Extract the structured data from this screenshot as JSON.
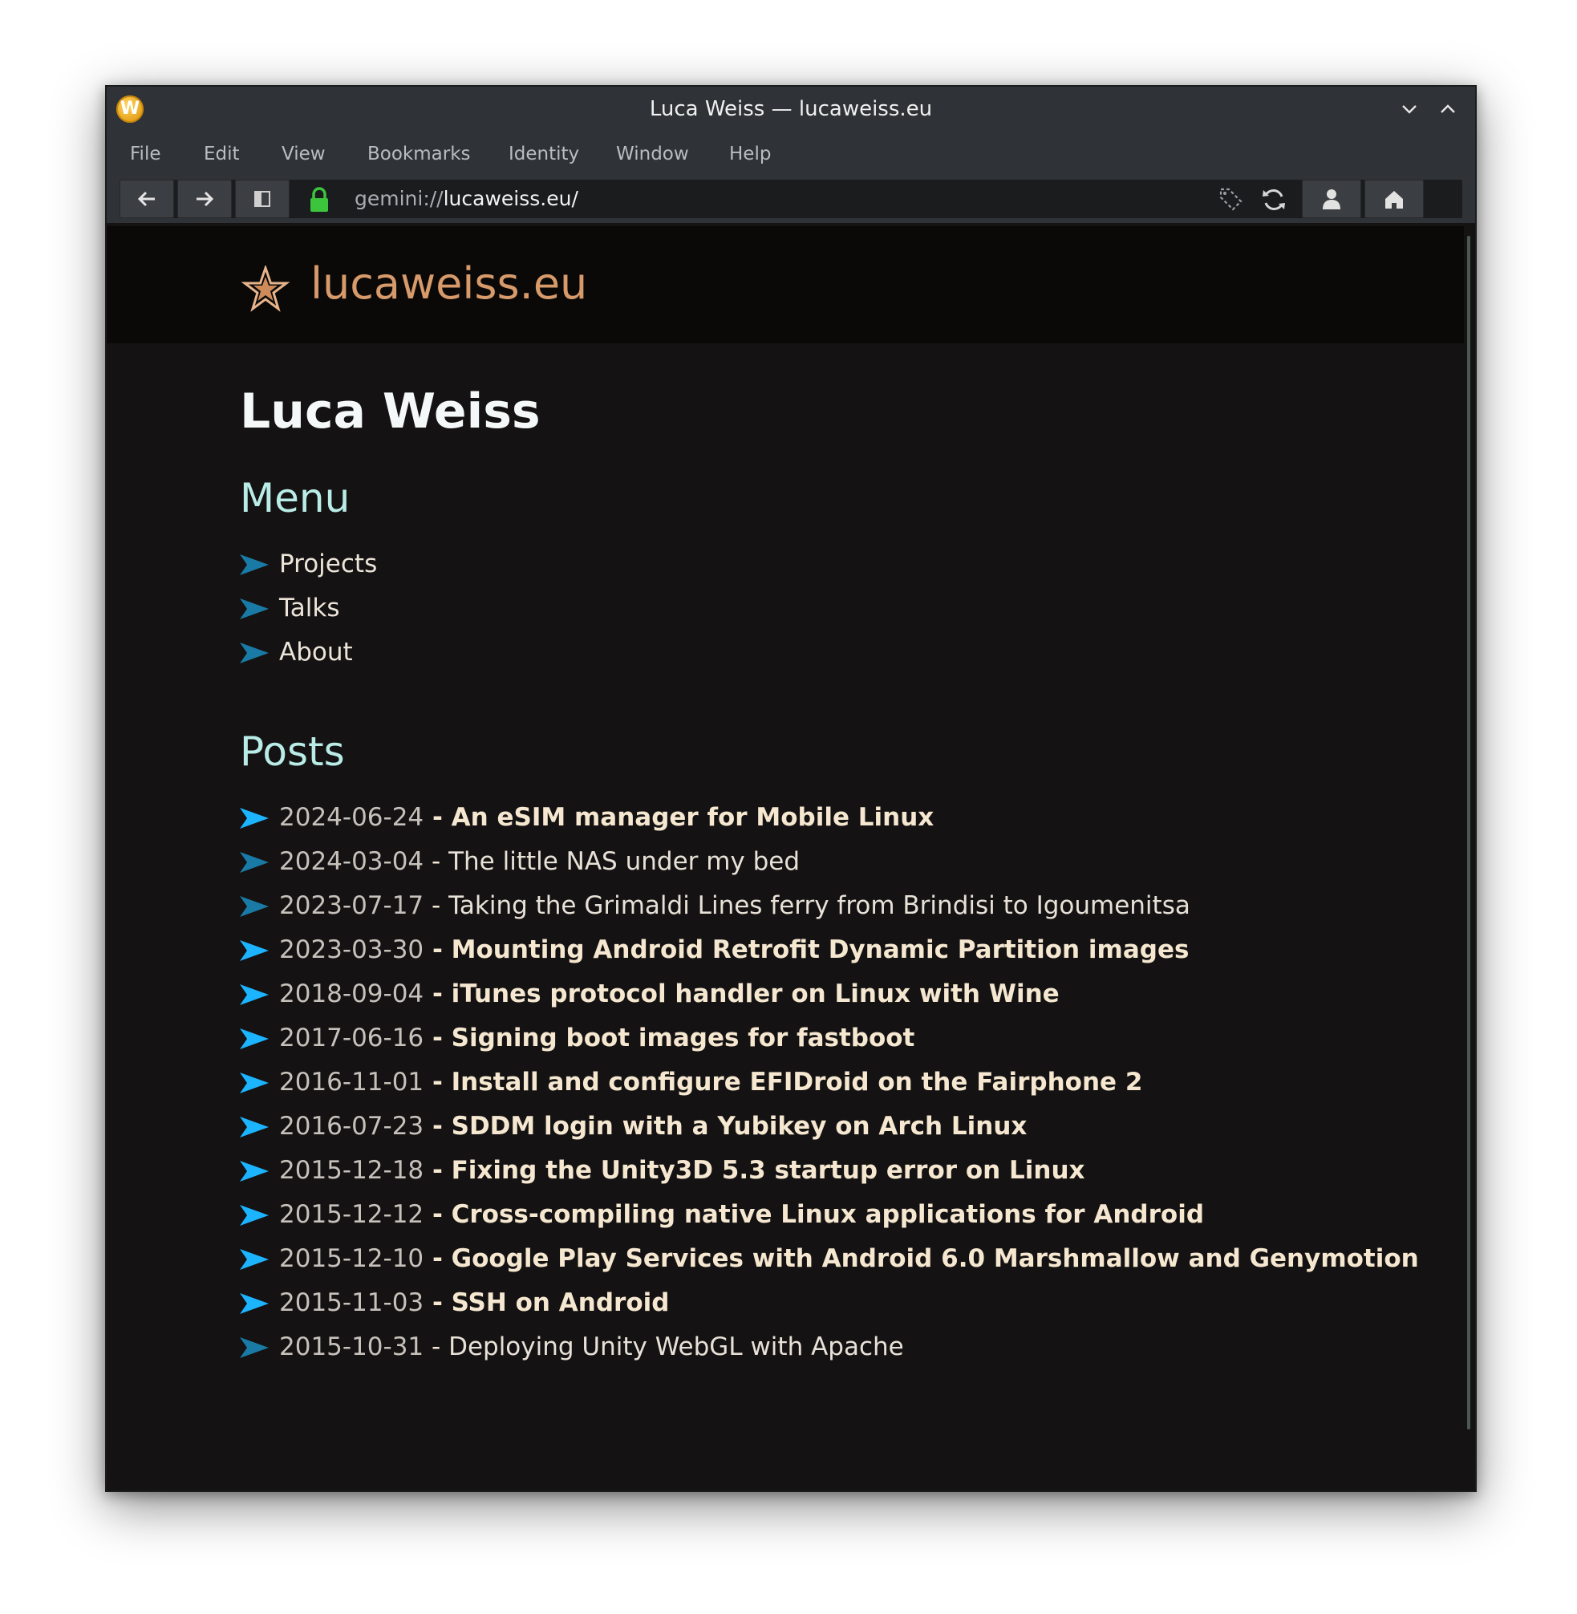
{
  "window": {
    "title": "Luca Weiss — lucaweiss.eu",
    "app_icon": "W"
  },
  "menubar": [
    "File",
    "Edit",
    "View",
    "Bookmarks",
    "Identity",
    "Window",
    "Help"
  ],
  "toolbar": {
    "url_scheme": "gemini://",
    "url_host": "lucaweiss.eu/",
    "buttons": [
      "back-icon",
      "forward-icon",
      "sidebar-icon",
      "bookmark-tag-icon",
      "reload-icon",
      "identity-icon",
      "home-icon"
    ]
  },
  "page": {
    "site_name": "lucaweiss.eu",
    "heading": "Luca Weiss",
    "menu_heading": "Menu",
    "menu_links": [
      "Projects",
      "Talks",
      "About"
    ],
    "posts_heading": "Posts",
    "posts": [
      {
        "date": "2024-06-24",
        "title": "An eSIM manager for Mobile Linux",
        "visited": false
      },
      {
        "date": "2024-03-04",
        "title": "The little NAS under my bed",
        "visited": true
      },
      {
        "date": "2023-07-17",
        "title": "Taking the Grimaldi Lines ferry from Brindisi to Igoumenitsa",
        "visited": true
      },
      {
        "date": "2023-03-30",
        "title": "Mounting Android Retrofit Dynamic Partition images",
        "visited": false
      },
      {
        "date": "2018-09-04",
        "title": "iTunes protocol handler on Linux with Wine",
        "visited": false
      },
      {
        "date": "2017-06-16",
        "title": "Signing boot images for fastboot",
        "visited": false
      },
      {
        "date": "2016-11-01",
        "title": "Install and configure EFIDroid on the Fairphone 2",
        "visited": false
      },
      {
        "date": "2016-07-23",
        "title": "SDDM login with a Yubikey on Arch Linux",
        "visited": false
      },
      {
        "date": "2015-12-18",
        "title": "Fixing the Unity3D 5.3 startup error on Linux",
        "visited": false
      },
      {
        "date": "2015-12-12",
        "title": "Cross-compiling native Linux applications for Android",
        "visited": false
      },
      {
        "date": "2015-12-10",
        "title": "Google Play Services with Android 6.0 Marshmallow and Genymotion",
        "visited": false
      },
      {
        "date": "2015-11-03",
        "title": "SSH on Android",
        "visited": false
      },
      {
        "date": "2015-10-31",
        "title": "Deploying Unity WebGL with Apache",
        "visited": true
      }
    ],
    "separator": " - "
  },
  "colors": {
    "accent_arrow_new": "#1cb4ff",
    "accent_arrow_visited": "#1a7aa6",
    "site_name": "#d79a6a",
    "heading2": "#b9ece7",
    "lock": "#3cc43c"
  }
}
